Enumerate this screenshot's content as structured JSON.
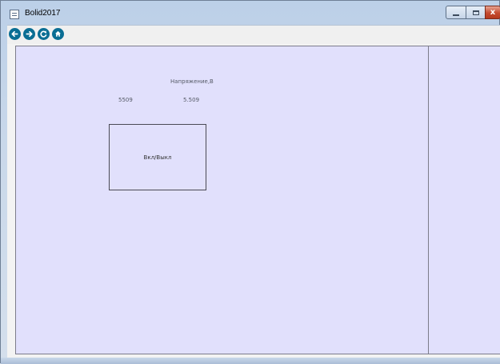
{
  "window": {
    "title": "Bolid2017",
    "controls": {
      "minimize": "",
      "maximize": "",
      "close": "x"
    }
  },
  "toolbar": {
    "buttons": [
      {
        "name": "back",
        "icon": "arrow-left-icon"
      },
      {
        "name": "forward",
        "icon": "arrow-right-icon"
      },
      {
        "name": "refresh",
        "icon": "refresh-icon"
      },
      {
        "name": "home",
        "icon": "home-icon"
      }
    ],
    "accent_color": "#0a6e94"
  },
  "main": {
    "voltage_title": "Напряжение,В",
    "raw_value": "5509",
    "voltage_value": "5.509",
    "toggle_label": "Вкл/Выкл",
    "panel_color": "#e1e0fc"
  }
}
